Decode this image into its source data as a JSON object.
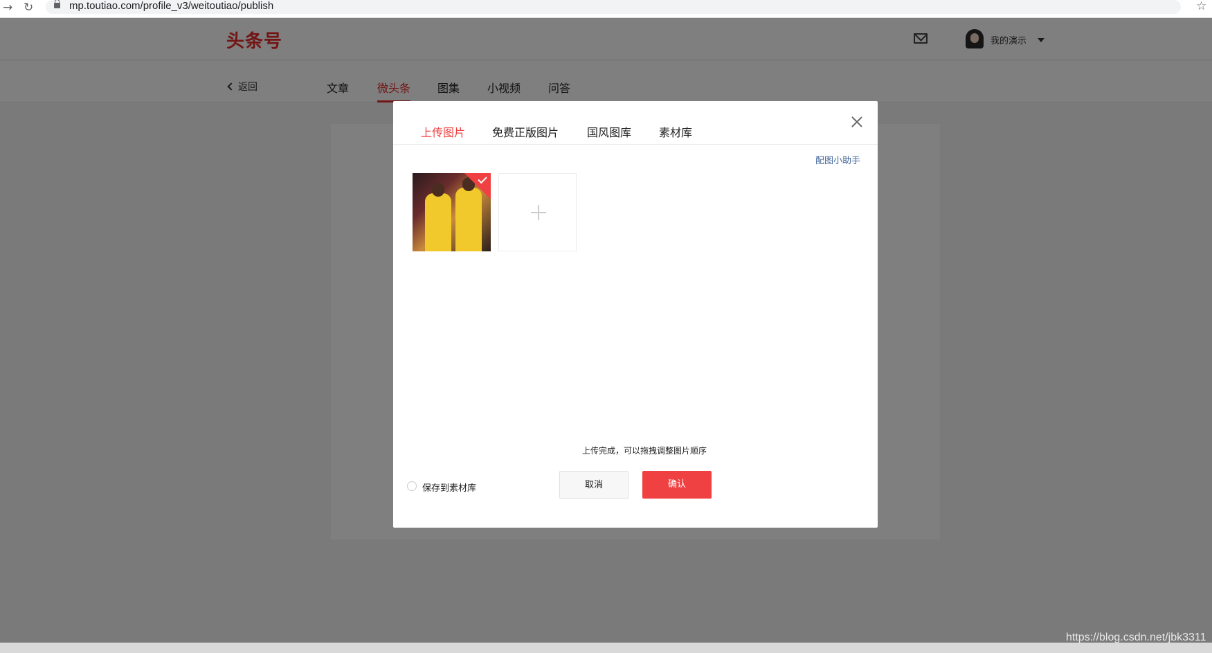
{
  "browser": {
    "back_glyph": "→",
    "reload_glyph": "↻",
    "url": "mp.toutiao.com/profile_v3/weitoutiao/publish",
    "star_glyph": "☆"
  },
  "header": {
    "logo": "头条号",
    "user_name": "我的演示",
    "icons": [
      "mail-icon",
      "avatar",
      "caret-down-icon"
    ]
  },
  "subnav": {
    "back_label": "返回",
    "tabs": [
      "文章",
      "微头条",
      "图集",
      "小视频",
      "问答"
    ],
    "active_tab": "微头条"
  },
  "modal": {
    "tabs": [
      "上传图片",
      "免费正版图片",
      "国风图库",
      "素材库"
    ],
    "active_tab": "上传图片",
    "helper_link": "配图小助手",
    "upload_status": "上传完成，可以拖拽调整图片顺序",
    "save_to_library_label": "保存到素材库",
    "cancel_label": "取消",
    "confirm_label": "确认"
  },
  "colors": {
    "brand_red": "#e42a2a",
    "accent": "#f04142",
    "link": "#406599"
  },
  "watermark": "https://blog.csdn.net/jbk3311"
}
